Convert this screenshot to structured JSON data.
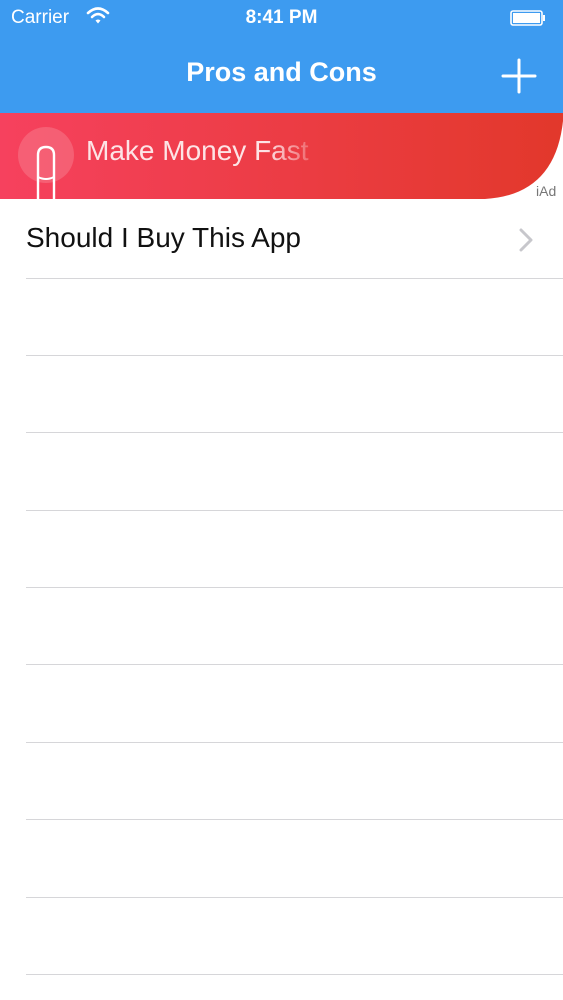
{
  "status_bar": {
    "carrier": "Carrier",
    "time": "8:41 PM"
  },
  "nav": {
    "title": "Pros and Cons",
    "add_icon": "plus-icon"
  },
  "ad": {
    "text": "Make Money Fast",
    "tag": "iAd",
    "icon": "tap-finger-icon"
  },
  "list": {
    "items": [
      {
        "title": "Should I Buy This App"
      }
    ],
    "empty_rows": 9
  },
  "colors": {
    "nav": "#3d9bf0",
    "ad_left": "#f6415e",
    "ad_right": "#e2382b"
  }
}
